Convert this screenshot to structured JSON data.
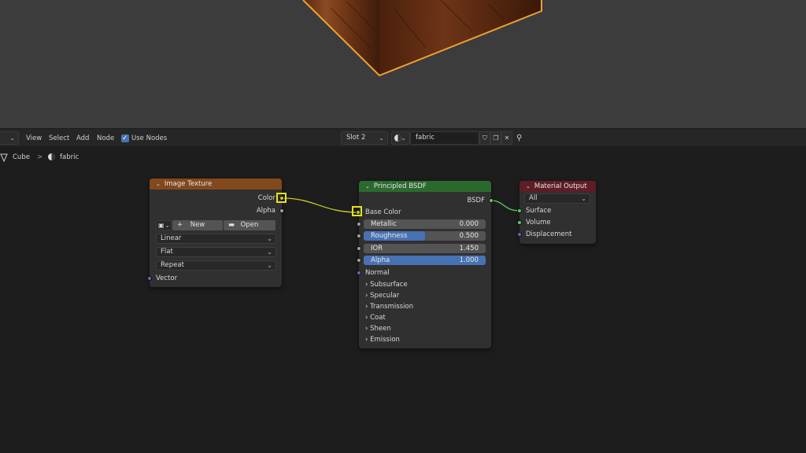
{
  "header": {
    "mode_chev": "⌄",
    "menus": [
      "View",
      "Select",
      "Add",
      "Node"
    ],
    "use_nodes_label": "Use Nodes",
    "slot": "Slot 2",
    "material_name": "fabric"
  },
  "breadcrumb": {
    "object": "Cube",
    "separator": ">",
    "material": "fabric"
  },
  "image_texture": {
    "title": "Image Texture",
    "out_color": "Color",
    "out_alpha": "Alpha",
    "new_label": "New",
    "open_label": "Open",
    "interpolation": "Linear",
    "projection": "Flat",
    "extension": "Repeat",
    "in_vector": "Vector"
  },
  "bsdf": {
    "title": "Principled BSDF",
    "out_bsdf": "BSDF",
    "base_color": "Base Color",
    "metallic_label": "Metallic",
    "metallic_value": "0.000",
    "metallic_fraction": 0,
    "roughness_label": "Roughness",
    "roughness_value": "0.500",
    "roughness_fraction": 0.5,
    "ior_label": "IOR",
    "ior_value": "1.450",
    "ior_fraction": 0,
    "alpha_label": "Alpha",
    "alpha_value": "1.000",
    "alpha_fraction": 1,
    "normal": "Normal",
    "panels": [
      "Subsurface",
      "Specular",
      "Transmission",
      "Coat",
      "Sheen",
      "Emission"
    ]
  },
  "material_output": {
    "title": "Material Output",
    "target": "All",
    "in_surface": "Surface",
    "in_volume": "Volume",
    "in_displacement": "Displacement"
  },
  "colors": {
    "texture_header": "#83491c",
    "shader_header": "#2b6a2e",
    "output_header": "#5f1d25",
    "highlight": "#e6e21a",
    "selection_outline": "#f0a030",
    "accent_blue": "#4772b3"
  }
}
